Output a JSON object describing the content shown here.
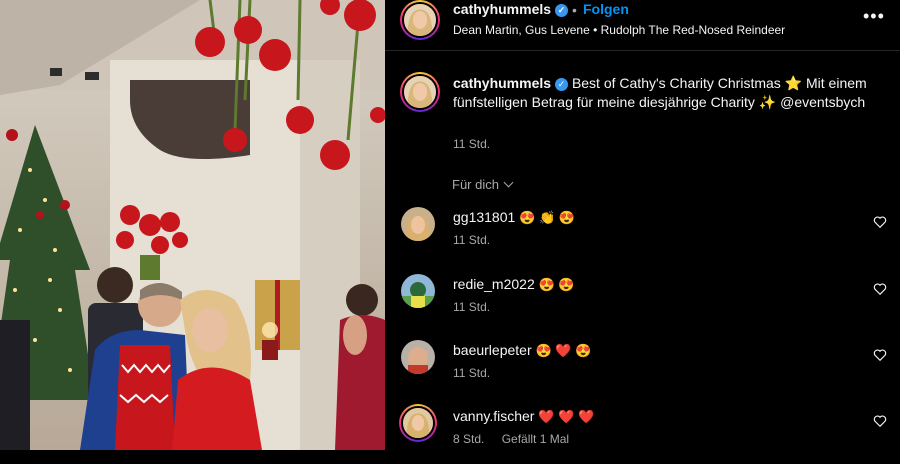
{
  "post": {
    "username": "cathyhummels",
    "follow_label": "Folgen",
    "separator": "•",
    "music": "Dean Martin, Gus Levene • Rudolph The Red-Nosed Reindeer",
    "more_label": "•••"
  },
  "caption": {
    "username": "cathyhummels",
    "text": "Best of Cathy's Charity Christmas ⭐  Mit einem fünfstelligen Betrag für meine diesjährige Charity ✨ @eventsbych",
    "time": "11 Std."
  },
  "comments_filter": {
    "label": "Für dich"
  },
  "comments": [
    {
      "username": "gg131801",
      "emoji": "😍 👏 😍",
      "time": "11 Std.",
      "likes": ""
    },
    {
      "username": "redie_m2022",
      "emoji": "😍 😍",
      "time": "11 Std.",
      "likes": ""
    },
    {
      "username": "baeurlepeter",
      "emoji": "😍 ❤️ 😍",
      "time": "11 Std.",
      "likes": ""
    },
    {
      "username": "vanny.fischer",
      "emoji": "❤️ ❤️ ❤️",
      "time": "8 Std.",
      "likes": "Gefällt 1 Mal"
    }
  ],
  "colors": {
    "accent": "#0095f6",
    "verified": "#3897f0",
    "background": "#000000",
    "secondary_text": "#a8a8a8"
  },
  "icons": {
    "verified": "verified-badge-icon",
    "more": "more-options-icon",
    "heart": "heart-outline-icon",
    "chevron": "chevron-down-icon"
  }
}
